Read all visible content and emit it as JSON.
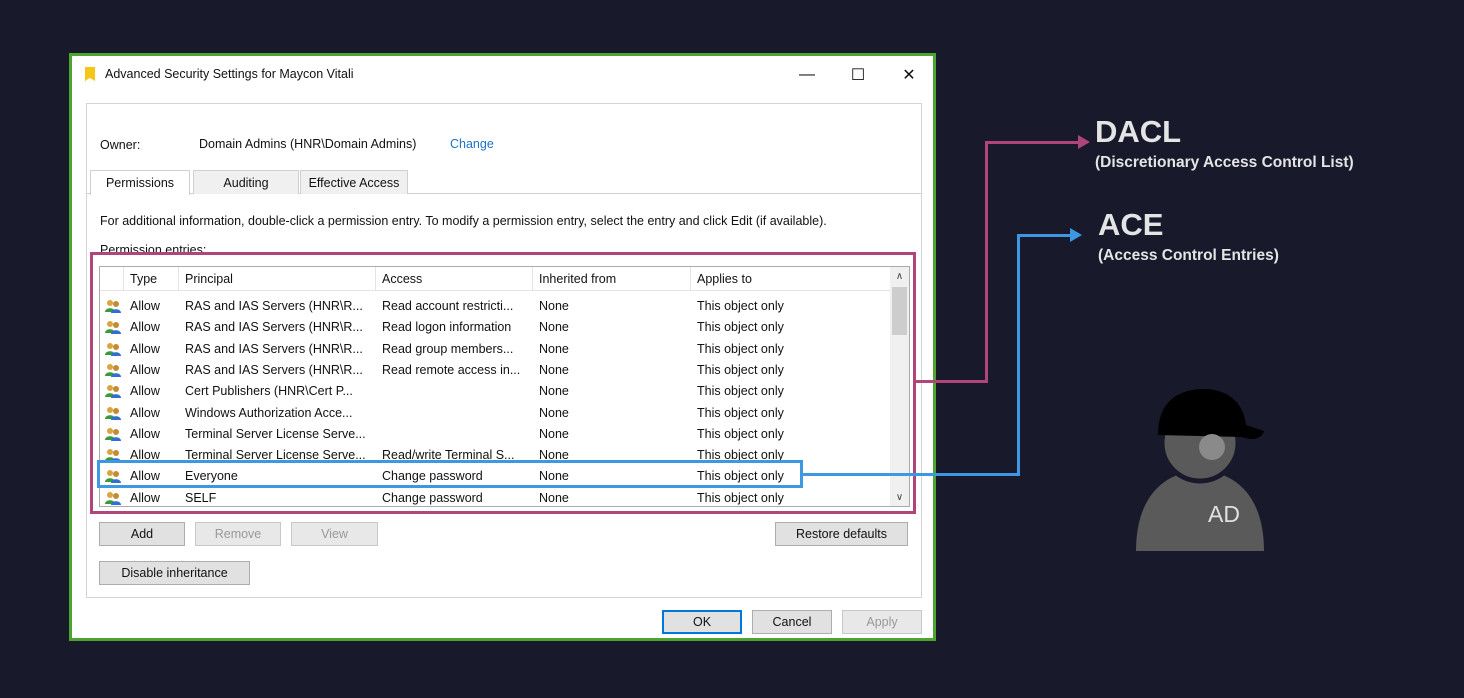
{
  "window": {
    "title": "Advanced Security Settings for Maycon Vitali",
    "min_glyph": "—",
    "max_glyph": "☐",
    "close_glyph": "✕"
  },
  "owner": {
    "label": "Owner:",
    "value": "Domain Admins (HNR\\Domain Admins)",
    "change_link": "Change"
  },
  "tabs": [
    {
      "label": "Permissions",
      "active": true
    },
    {
      "label": "Auditing",
      "active": false
    },
    {
      "label": "Effective Access",
      "active": false
    }
  ],
  "info_text": "For additional information, double-click a permission entry. To modify a permission entry, select the entry and click Edit (if available).",
  "entries_label": "Permission entries:",
  "columns": [
    "Type",
    "Principal",
    "Access",
    "Inherited from",
    "Applies to"
  ],
  "entries": [
    {
      "type": "Allow",
      "principal": "RAS and IAS Servers (HNR\\R...",
      "access": "Read account restricti...",
      "inherited": "None",
      "applies": "This object only"
    },
    {
      "type": "Allow",
      "principal": "RAS and IAS Servers (HNR\\R...",
      "access": "Read logon information",
      "inherited": "None",
      "applies": "This object only"
    },
    {
      "type": "Allow",
      "principal": "RAS and IAS Servers (HNR\\R...",
      "access": "Read group members...",
      "inherited": "None",
      "applies": "This object only"
    },
    {
      "type": "Allow",
      "principal": "RAS and IAS Servers (HNR\\R...",
      "access": "Read remote access in...",
      "inherited": "None",
      "applies": "This object only"
    },
    {
      "type": "Allow",
      "principal": "Cert Publishers (HNR\\Cert P...",
      "access": "",
      "inherited": "None",
      "applies": "This object only"
    },
    {
      "type": "Allow",
      "principal": "Windows Authorization Acce...",
      "access": "",
      "inherited": "None",
      "applies": "This object only"
    },
    {
      "type": "Allow",
      "principal": "Terminal Server License Serve...",
      "access": "",
      "inherited": "None",
      "applies": "This object only"
    },
    {
      "type": "Allow",
      "principal": "Terminal Server License Serve...",
      "access": "Read/write Terminal S...",
      "inherited": "None",
      "applies": "This object only"
    },
    {
      "type": "Allow",
      "principal": "Everyone",
      "access": "Change password",
      "inherited": "None",
      "applies": "This object only"
    },
    {
      "type": "Allow",
      "principal": "SELF",
      "access": "Change password",
      "inherited": "None",
      "applies": "This object only"
    }
  ],
  "buttons": {
    "add": "Add",
    "remove": "Remove",
    "view": "View",
    "restore": "Restore defaults",
    "disable_inheritance": "Disable inheritance",
    "ok": "OK",
    "cancel": "Cancel",
    "apply": "Apply"
  },
  "annotations": {
    "dacl_title": "DACL",
    "dacl_sub": "(Discretionary Access Control List)",
    "ace_title": "ACE",
    "ace_sub": "(Access Control Entries)",
    "avatar_label": "AD"
  },
  "colors": {
    "dacl": "#b0457a",
    "ace": "#3d97e2",
    "window_border": "#4ca52e"
  },
  "icons": {
    "row": "users-icon",
    "scroll_up": "chevron-up-icon",
    "scroll_down": "chevron-down-icon"
  }
}
